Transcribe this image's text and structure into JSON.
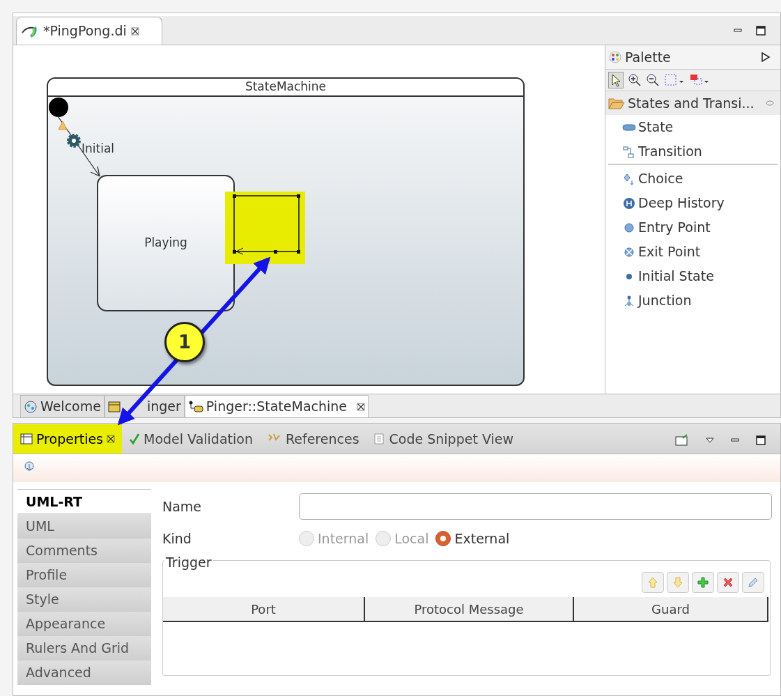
{
  "editor": {
    "tab": {
      "label": "*PingPong.di",
      "selected": true
    },
    "diagram": {
      "title": "StateMachine",
      "initial_label": "Initial",
      "state_name": "Playing",
      "selected_box": true
    },
    "bottom_tabs": [
      {
        "label": "Welcome",
        "selected": false,
        "kind": "welcome"
      },
      {
        "label": "inger",
        "selected": false,
        "kind": "capsule"
      },
      {
        "label": "Pinger::StateMachine",
        "selected": true,
        "kind": "statemachine"
      }
    ]
  },
  "palette": {
    "title": "Palette",
    "group": {
      "label": "States and Transi...",
      "expanded": true
    },
    "sections": [
      [
        {
          "label": "State",
          "kind": "state"
        },
        {
          "label": "Transition",
          "kind": "transition"
        }
      ],
      [
        {
          "label": "Choice",
          "kind": "choice"
        },
        {
          "label": "Deep History",
          "kind": "history"
        },
        {
          "label": "Entry Point",
          "kind": "entry"
        },
        {
          "label": "Exit Point",
          "kind": "exit"
        },
        {
          "label": "Initial State",
          "kind": "initial"
        },
        {
          "label": "Junction",
          "kind": "junction"
        }
      ]
    ]
  },
  "properties": {
    "tabs": [
      {
        "label": "Properties",
        "selected": true,
        "kind": "properties"
      },
      {
        "label": "Model Validation",
        "selected": false,
        "kind": "validation"
      },
      {
        "label": "References",
        "selected": false,
        "kind": "references"
      },
      {
        "label": "Code Snippet View",
        "selected": false,
        "kind": "snippet"
      }
    ],
    "side_tabs": [
      {
        "label": "UML-RT",
        "selected": true
      },
      {
        "label": "UML",
        "selected": false
      },
      {
        "label": "Comments",
        "selected": false
      },
      {
        "label": "Profile",
        "selected": false
      },
      {
        "label": "Style",
        "selected": false
      },
      {
        "label": "Appearance",
        "selected": false
      },
      {
        "label": "Rulers And Grid",
        "selected": false
      },
      {
        "label": "Advanced",
        "selected": false
      }
    ],
    "name": {
      "label": "Name"
    },
    "kind": {
      "label": "Kind",
      "options": [
        {
          "label": "Internal",
          "selected": false,
          "disabled": true
        },
        {
          "label": "Local",
          "selected": false,
          "disabled": true
        },
        {
          "label": "External",
          "selected": true,
          "disabled": false
        }
      ]
    },
    "trigger": {
      "title": "Trigger",
      "columns": [
        "Port",
        "Protocol Message",
        "Guard"
      ]
    }
  },
  "callout": {
    "number": "1"
  }
}
